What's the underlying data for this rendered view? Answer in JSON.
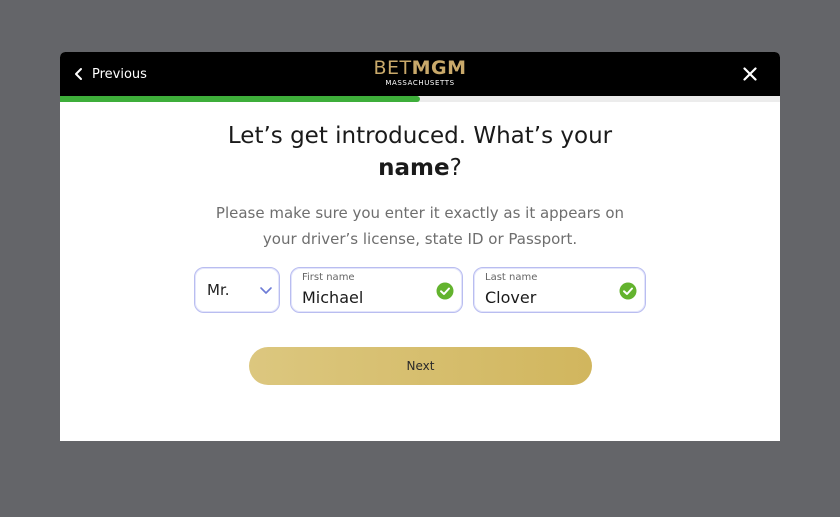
{
  "header": {
    "previous_label": "Previous",
    "logo_bet": "BET",
    "logo_mgm": "MGM",
    "logo_state": "MASSACHUSETTS",
    "close_icon": "close-icon",
    "back_icon": "chevron-left-icon"
  },
  "progress": {
    "fraction": 0.5,
    "color": "#3eae3a"
  },
  "main": {
    "heading_part1": "Let’s get introduced. What’s your",
    "heading_bold": "name",
    "heading_end": "?",
    "subtext_line1": "Please make sure you enter it exactly as it appears on",
    "subtext_line2": "your driver’s license, state ID or Passport."
  },
  "form": {
    "title_value": "Mr.",
    "first_name_label": "First name",
    "first_name_value": "Michael",
    "last_name_label": "Last name",
    "last_name_value": "Clover",
    "valid_icon": "check-circle-icon",
    "valid_color": "#63b32e"
  },
  "actions": {
    "next_label": "Next",
    "accent": "#d4bb66"
  }
}
